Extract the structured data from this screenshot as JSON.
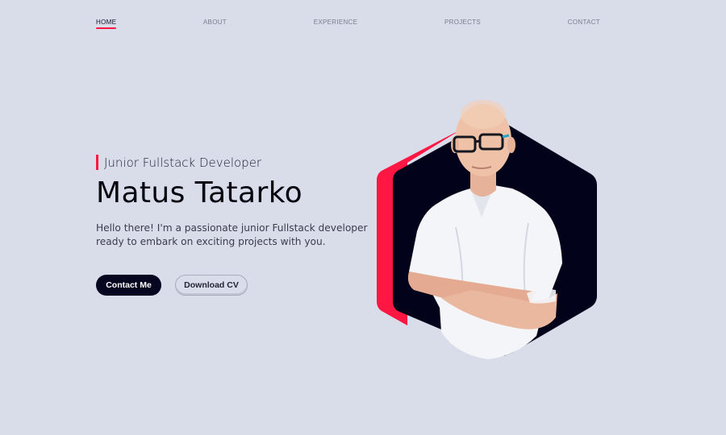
{
  "nav": {
    "items": [
      {
        "label": "HOME",
        "active": true
      },
      {
        "label": "ABOUT",
        "active": false
      },
      {
        "label": "EXPERIENCE",
        "active": false
      },
      {
        "label": "PROJECTS",
        "active": false
      },
      {
        "label": "CONTACT",
        "active": false
      }
    ]
  },
  "hero": {
    "role": "Junior Fullstack Developer",
    "name": "Matus Tatarko",
    "intro": "Hello there! I'm a passionate junior Fullstack developer ready to embark on exciting projects with you.",
    "primary_button": "Contact Me",
    "secondary_button": "Download CV"
  },
  "colors": {
    "background": "#d9dce9",
    "accent": "#ff1744",
    "dark": "#060621"
  }
}
